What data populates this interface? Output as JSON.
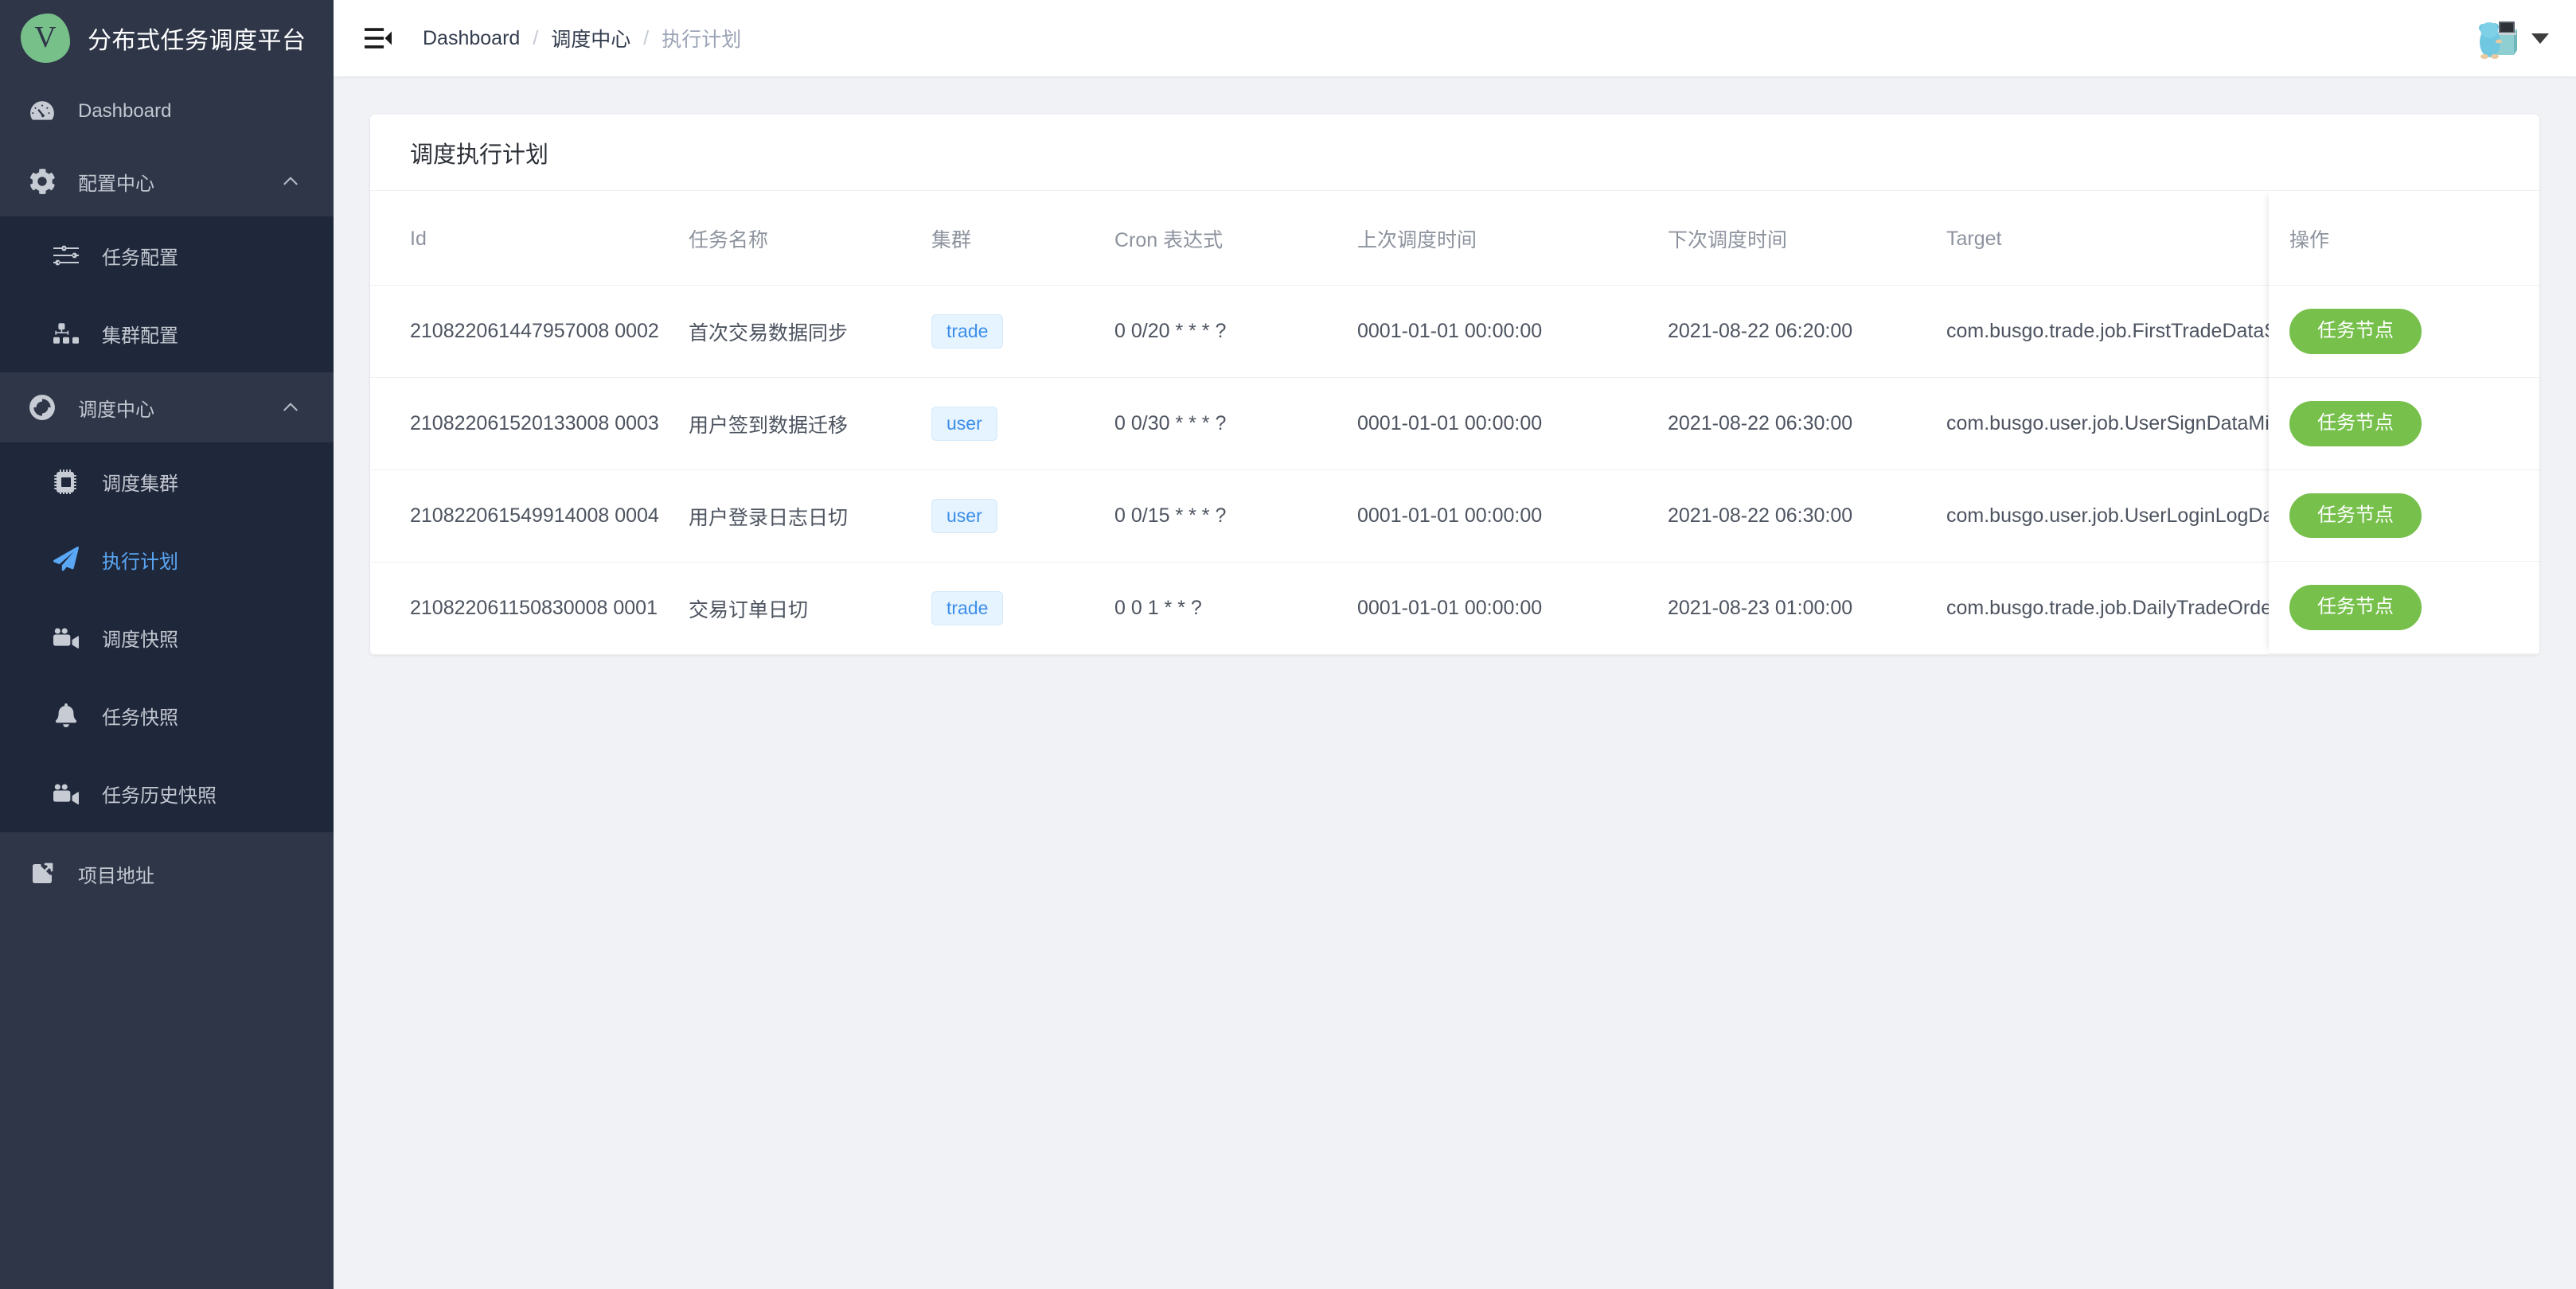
{
  "brand": {
    "logo_letter": "V",
    "title": "分布式任务调度平台"
  },
  "sidebar": {
    "items": [
      {
        "label": "Dashboard",
        "icon": "dashboard-icon",
        "type": "item"
      },
      {
        "label": "配置中心",
        "icon": "gear-icon",
        "type": "group",
        "expanded": true,
        "arrow": "chevron-up-icon"
      },
      {
        "label": "任务配置",
        "icon": "sliders-icon",
        "type": "sub"
      },
      {
        "label": "集群配置",
        "icon": "sitemap-icon",
        "type": "sub"
      },
      {
        "label": "调度中心",
        "icon": "donut-icon",
        "type": "group",
        "expanded": true,
        "arrow": "chevron-up-icon"
      },
      {
        "label": "调度集群",
        "icon": "microchip-icon",
        "type": "sub"
      },
      {
        "label": "执行计划",
        "icon": "paper-plane-icon",
        "type": "sub",
        "active": true
      },
      {
        "label": "调度快照",
        "icon": "video-camera-icon",
        "type": "sub"
      },
      {
        "label": "任务快照",
        "icon": "bell-icon",
        "type": "sub"
      },
      {
        "label": "任务历史快照",
        "icon": "video-camera-icon",
        "type": "sub"
      },
      {
        "label": "项目地址",
        "icon": "external-link-icon",
        "type": "item"
      }
    ]
  },
  "topbar": {
    "fold_icon": "menu-fold-icon",
    "breadcrumb": [
      {
        "label": "Dashboard",
        "current": false
      },
      {
        "label": "调度中心",
        "current": false
      },
      {
        "label": "执行计划",
        "current": true
      }
    ],
    "separator": "/",
    "avatar": "user-avatar",
    "caret": "chevron-down-icon"
  },
  "card": {
    "title": "调度执行计划"
  },
  "table": {
    "columns": [
      "Id",
      "任务名称",
      "集群",
      "Cron 表达式",
      "上次调度时间",
      "下次调度时间",
      "Target",
      "操作"
    ],
    "action_label": "任务节点",
    "rows": [
      {
        "id": "210822061447957008 0002",
        "name": "首次交易数据同步",
        "cluster": "trade",
        "cron": "0 0/20 * * * ?",
        "last_time": "0001-01-01 00:00:00",
        "next_time": "2021-08-22 06:20:00",
        "target": "com.busgo.trade.job.FirstTradeDataSyncJob",
        "action": "任务节点"
      },
      {
        "id": "210822061520133008 0003",
        "name": "用户签到数据迁移",
        "cluster": "user",
        "cron": "0 0/30 * * * ?",
        "last_time": "0001-01-01 00:00:00",
        "next_time": "2021-08-22 06:30:00",
        "target": "com.busgo.user.job.UserSignDataMigrateJob",
        "action": "任务节点"
      },
      {
        "id": "210822061549914008 0004",
        "name": "用户登录日志日切",
        "cluster": "user",
        "cron": "0 0/15 * * * ?",
        "last_time": "0001-01-01 00:00:00",
        "next_time": "2021-08-22 06:30:00",
        "target": "com.busgo.user.job.UserLoginLogDailyJob",
        "action": "任务节点"
      },
      {
        "id": "210822061150830008 0001",
        "name": "交易订单日切",
        "cluster": "trade",
        "cron": "0 0 1 * * ?",
        "last_time": "0001-01-01 00:00:00",
        "next_time": "2021-08-23 01:00:00",
        "target": "com.busgo.trade.job.DailyTradeOrderJob",
        "action": "任务节点"
      }
    ]
  },
  "colors": {
    "sidebar_bg": "#2e3648",
    "submenu_bg": "#1f273a",
    "accent_blue": "#5aa7f5",
    "action_green": "#76c04b",
    "tag_blue": "#3c8ee8",
    "page_bg": "#f0f2f5"
  }
}
